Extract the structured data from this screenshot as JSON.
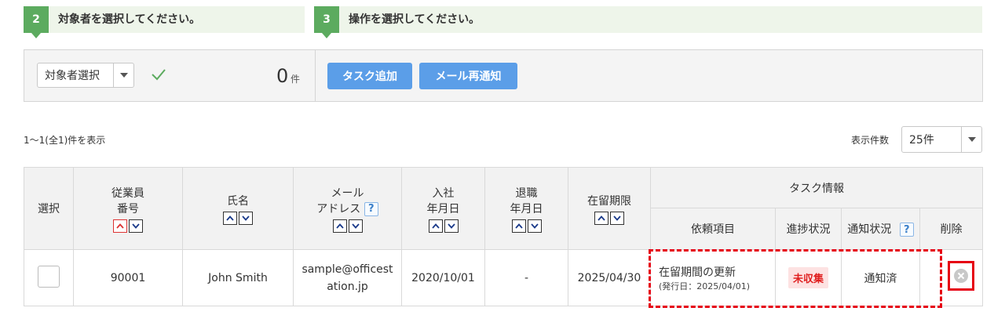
{
  "steps": [
    {
      "number": "2",
      "title": "対象者を選択してください。"
    },
    {
      "number": "3",
      "title": "操作を選択してください。"
    }
  ],
  "target_select": {
    "value": "対象者選択"
  },
  "selected_count": {
    "value": "0",
    "unit": "件"
  },
  "actions": {
    "add_task": "タスク追加",
    "resend_mail": "メール再通知"
  },
  "summary": "1〜1(全1)件を表示",
  "per_page": {
    "label": "表示件数",
    "value": "25件"
  },
  "table": {
    "headers": {
      "select": "選択",
      "employee_no": [
        "従業員",
        "番号"
      ],
      "name": "氏名",
      "email": [
        "メール",
        "アドレス"
      ],
      "join": [
        "入社",
        "年月日"
      ],
      "leave": [
        "退職",
        "年月日"
      ],
      "residence": "在留期限",
      "task_info": "タスク情報",
      "request_item": "依頼項目",
      "progress": "進捗状況",
      "notify": "通知状況",
      "delete": "削除",
      "help": "?"
    },
    "rows": [
      {
        "employee_no": "90001",
        "name": "John Smith",
        "email": [
          "sample@officest",
          "ation.jp"
        ],
        "join_date": "2020/10/01",
        "leave_date": "-",
        "residence_limit": "2025/04/30",
        "request_item": "在留期間の更新",
        "issue_date": "(発行日：2025/04/01)",
        "progress": "未収集",
        "notify": "通知済"
      }
    ]
  },
  "colors": {
    "step_green": "#5cab5f",
    "button_blue": "#5b9ee8",
    "highlight_red": "#e60012",
    "status_red": "#e02020"
  }
}
